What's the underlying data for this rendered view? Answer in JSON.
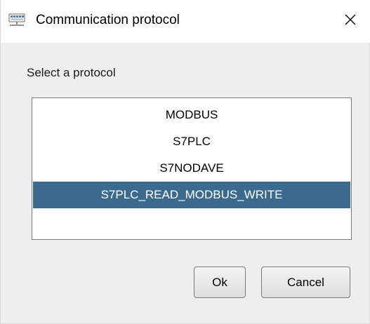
{
  "window": {
    "title": "Communication protocol",
    "app_icon": "network-icon",
    "close_icon": "close-icon"
  },
  "dialog": {
    "prompt": "Select a protocol",
    "protocols": [
      {
        "label": "MODBUS",
        "selected": false
      },
      {
        "label": "S7PLC",
        "selected": false
      },
      {
        "label": "S7NODAVE",
        "selected": false
      },
      {
        "label": "S7PLC_READ_MODBUS_WRITE",
        "selected": true
      }
    ],
    "ok_label": "Ok",
    "cancel_label": "Cancel"
  },
  "colors": {
    "selection": "#3c6a8f",
    "dialog_background": "#eeeeee"
  }
}
